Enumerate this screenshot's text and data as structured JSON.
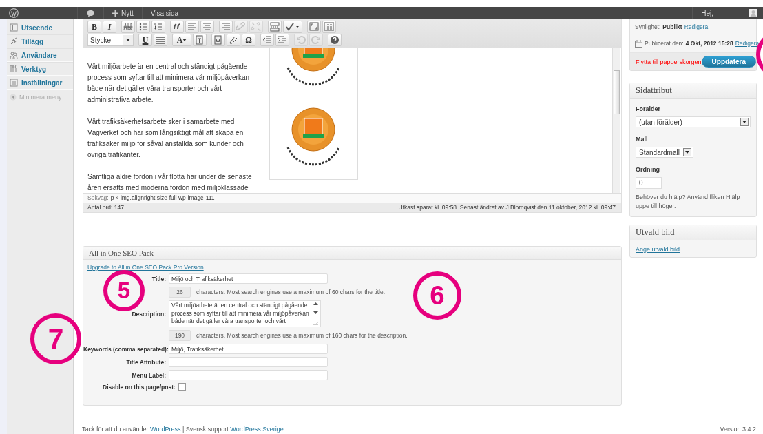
{
  "admin_bar": {
    "new_label": "Nytt",
    "view_label": "Visa sida",
    "greeting": "Hej,"
  },
  "sidebar": {
    "items": [
      {
        "label": "Utseende"
      },
      {
        "label": "Tillägg"
      },
      {
        "label": "Användare"
      },
      {
        "label": "Verktyg"
      },
      {
        "label": "Inställningar"
      }
    ],
    "collapse": "Minimera meny"
  },
  "editor": {
    "toolbar": {
      "top_row": [
        {
          "kind": "text",
          "label": "B",
          "disabled": false
        },
        {
          "kind": "text",
          "label": "I",
          "disabled": false
        },
        {
          "kind": "icon",
          "disabled": false
        },
        {
          "kind": "icon",
          "disabled": false
        },
        {
          "kind": "icon",
          "disabled": false
        },
        {
          "kind": "icon",
          "disabled": false
        },
        {
          "kind": "icon",
          "disabled": false
        },
        {
          "kind": "icon",
          "disabled": false
        },
        {
          "kind": "icon",
          "disabled": false
        },
        {
          "kind": "icon",
          "disabled": true
        },
        {
          "kind": "icon",
          "disabled": true
        },
        {
          "kind": "icon",
          "disabled": false
        },
        {
          "kind": "icon",
          "disabled": false
        },
        {
          "kind": "icon",
          "disabled": false
        },
        {
          "kind": "icon",
          "disabled": false
        }
      ],
      "bottom_row": [
        {
          "kind": "select",
          "label": "Stycke"
        },
        {
          "kind": "text",
          "label": "U",
          "disabled": false
        },
        {
          "kind": "icon",
          "disabled": false
        },
        {
          "kind": "text",
          "label": "A",
          "disabled": false
        },
        {
          "kind": "icon",
          "disabled": false
        },
        {
          "kind": "icon",
          "disabled": false
        },
        {
          "kind": "icon",
          "disabled": false
        },
        {
          "kind": "text",
          "label": "Ω",
          "disabled": false
        },
        {
          "kind": "icon",
          "disabled": false
        },
        {
          "kind": "icon",
          "disabled": false
        },
        {
          "kind": "icon",
          "disabled": true
        },
        {
          "kind": "icon",
          "disabled": true
        },
        {
          "kind": "icon",
          "disabled": false
        }
      ]
    },
    "paragraphs": [
      "Vårt miljöarbete är en central och ständigt pågående process som syftar till att minimera vår miljöpåverkan både när det gäller våra transporter och vårt administrativa arbete.",
      "Vårt trafiksäkerhetsarbete sker i samarbete med Vägverket och har som långsiktigt mål att skapa en trafiksäker miljö för såväl anställda som kunder och övriga trafikanter.",
      "Samtliga äldre fordon i vår flotta har under de senaste åren ersatts med moderna fordon med miljöklassade"
    ],
    "path_label": "Sökväg:",
    "path": "p » img.alignright size-full wp-image-111",
    "word_count": "Antal ord: 147",
    "save_status": "Utkast sparat kl. 09:58. Senast ändrat av J.Blomqvist den 11 oktober, 2012 kl. 09:47"
  },
  "publish": {
    "visibility_label": "Synlighet:",
    "visibility": "Publikt",
    "visibility_edit": "Redigera",
    "date_label": "Publicerat den:",
    "date": "4 Okt, 2012 15:28",
    "date_edit": "Redigera",
    "trash": "Flytta till papperskorgen",
    "update": "Uppdatera"
  },
  "page_attributes": {
    "title": "Sidattribut",
    "parent_label": "Förälder",
    "parent": "(utan förälder)",
    "template_label": "Mall",
    "template": "Standardmall",
    "order_label": "Ordning",
    "order": "0",
    "help": "Behöver du hjälp? Använd fliken Hjälp uppe till höger."
  },
  "featured_image": {
    "title": "Utvald bild",
    "link": "Ange utvald bild"
  },
  "seo": {
    "title": "All in One SEO Pack",
    "upgrade": "Upgrade to All in One SEO Pack Pro Version",
    "fields": [
      {
        "kind": "input",
        "label": "Title:",
        "value": "Miljö och Trafiksäkerhet"
      },
      {
        "kind": "counter",
        "count": "26",
        "hint": "characters. Most search engines use a maximum of 60 chars for the title."
      },
      {
        "kind": "textarea",
        "label": "Description:",
        "value": "Vårt miljöarbete är en central och ständigt pågående process som syftar till att minimera vår miljöpåverkan både när det gäller våra transporter och vårt"
      },
      {
        "kind": "counter",
        "count": "190",
        "hint": "characters. Most search engines use a maximum of 160 chars for the description."
      },
      {
        "kind": "input",
        "label": "Keywords (comma separated):",
        "value": "Miljö, Trafiksäkerhet"
      },
      {
        "kind": "input",
        "label": "Title Attribute:"
      },
      {
        "kind": "input",
        "label": "Menu Label:"
      },
      {
        "kind": "checkbox",
        "label": "Disable on this page/post:",
        "checked": false
      }
    ]
  },
  "footer": {
    "thanks": "Tack för att du använder",
    "link": "WordPress",
    "support": "| Svensk support",
    "support_link": "WordPress Sverige",
    "version": "Version 3.4.2"
  },
  "annotations": [
    {
      "kind": "numbered",
      "label": "5"
    },
    {
      "kind": "numbered",
      "label": "6"
    },
    {
      "kind": "numbered",
      "label": "7"
    },
    {
      "kind": "edge"
    }
  ]
}
